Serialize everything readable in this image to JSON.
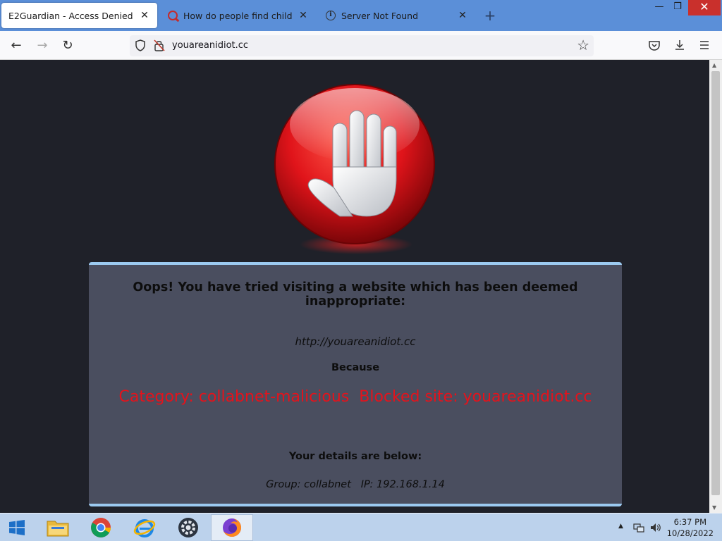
{
  "browser": {
    "tabs": [
      {
        "title": "E2Guardian - Access Denied",
        "active": true,
        "icon": "none"
      },
      {
        "title": "How do people find child porn",
        "active": false,
        "icon": "quora-icon"
      },
      {
        "title": "Server Not Found",
        "active": false,
        "icon": "info-icon"
      }
    ],
    "new_tab_label": "+",
    "url": "youareanidiot.cc"
  },
  "page": {
    "heading": "Oops! You have tried visiting a website which has been deemed inappropriate:",
    "blocked_url": "http://youareanidiot.cc",
    "because_label": "Because",
    "reason": "Category: collabnet-malicious  Blocked site: youareanidiot.cc",
    "details_title": "Your details are below:",
    "details": "Group: collabnet   IP: 192.168.1.14",
    "reason_color": "#e5121b",
    "panel_border_color": "#9ccaf0"
  },
  "taskbar": {
    "apps": [
      "start",
      "file-explorer",
      "chrome",
      "internet-explorer",
      "settings",
      "firefox"
    ],
    "time": "6:37 PM",
    "date": "10/28/2022"
  }
}
